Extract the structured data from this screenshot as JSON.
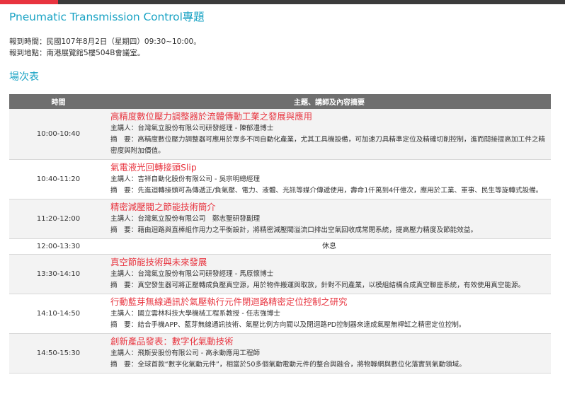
{
  "page": {
    "title": "Pneumatic Transmission Control專題",
    "checkin_time": "報到時間：民國107年8月2日（星期四）09:30~10:00。",
    "checkin_location": "報到地點：南港展覽館5樓504B會議室。",
    "section_title": "場次表"
  },
  "colors": {
    "accent_blue": "#19a3c4",
    "accent_red": "#e8343f",
    "header_gray": "#6f6f6f",
    "row_gray": "#f3f3f3"
  },
  "table": {
    "headers": {
      "time": "時間",
      "detail": "主題、講師及內容摘要"
    },
    "speaker_label": "主講人：",
    "summary_label": "摘　要：",
    "sessions": [
      {
        "time": "10:00-10:40",
        "title": "高精度數位壓力調整器於流體傳動工業之發展與應用",
        "speaker": "台灣氣立股份有限公司研發經理 - 陳郁澧博士",
        "summary": "高精度數位壓力調整器可應用於眾多不同自動化產業，尤其工具機設備，可加速刀具精準定位及精確切削控制，進而間接提高加工件之精密度與附加價值。"
      },
      {
        "time": "10:40-11:20",
        "title": "氣電液光回轉接頭Slip",
        "speaker": "吉祥自動化股份有限公司 - 吳宗明總經理",
        "summary": "先進迴轉接頭可為傳遞正/負氣壓、電力、液體、光訊等媒介傳遞使用，壽命1仟萬到4仟億次，應用於工業、軍事、民生等旋轉式設備。"
      },
      {
        "time": "11:20-12:00",
        "title": "精密減壓閥之節能技術簡介",
        "speaker": "台灣氣立股份有限公司　鄭志聖研發副理",
        "summary": "藉由迴路與直棒組作用力之平衡設計，將精密減壓閥溢流口排出空氣回收成常閉系統，提高壓力精度及節能效益。"
      },
      {
        "time": "12:00-13:30",
        "break_label": "休息"
      },
      {
        "time": "13:30-14:10",
        "title": "真空節能技術與未來發展",
        "speaker": "台灣氣立股份有限公司研發經理 - 馬原懷博士",
        "summary": "真空發生器可將正壓轉成負壓真空源，用於物件搬運與取放，針對不同產業，以模組結構合成真空聯座系統，有效使用真空能源。"
      },
      {
        "time": "14:10-14:50",
        "title": "行動藍芽無線通訊於氣壓執行元件閉迴路精密定位控制之研究",
        "speaker": "國立雲林科技大學機械工程系教授 - 任志強博士",
        "summary": "結合手機APP、藍芽無線通訊技術、氣壓比例方向閥以及閉迴路PD控制器來達成氣壓無桿缸之精密定位控制。"
      },
      {
        "time": "14:50-15:30",
        "title": "創新產品發表：數字化氣動技術",
        "speaker": "飛斯妥股份有限公司 - 高永動應用工程師",
        "summary": "全球首款“數字化氣動元件”，相當於50多個氣動電動元件的整合與融合，將物聯網與數位化落實到氣動領域。"
      }
    ]
  }
}
